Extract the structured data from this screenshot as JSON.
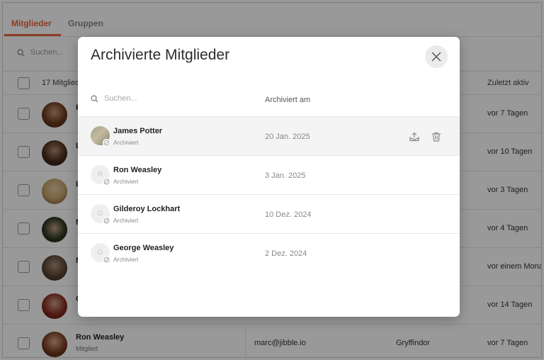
{
  "tabs": [
    {
      "label": "Mitglieder",
      "active": true
    },
    {
      "label": "Gruppen",
      "active": false
    }
  ],
  "background": {
    "search_placeholder": "Suchen...",
    "member_count_label": "17 Mitglied",
    "last_active_header": "Zuletzt aktiv",
    "rows": [
      {
        "initial": "H",
        "last_active": "vor 7 Tagen"
      },
      {
        "initial": "L",
        "last_active": "vor 10 Tagen"
      },
      {
        "initial": "L",
        "last_active": "vor 3 Tagen"
      },
      {
        "initial": "M",
        "last_active": "vor 4 Tagen"
      },
      {
        "initial": "M",
        "last_active": "vor einem Monat"
      },
      {
        "initial": "C",
        "last_active": "vor 14 Tagen"
      }
    ],
    "last_row": {
      "name": "Ron Weasley",
      "role": "Mitglied",
      "email": "marc@jibble.io",
      "group": "Gryffindor",
      "last_active": "vor 7 Tagen"
    }
  },
  "modal": {
    "title": "Archivierte Mitglieder",
    "search_placeholder": "Suchen...",
    "column_header": "Archiviert am",
    "members": [
      {
        "name": "James Potter",
        "status": "Archiviert",
        "date": "20 Jan. 2025",
        "avatar": "photo",
        "initial": ""
      },
      {
        "name": "Ron Weasley",
        "status": "Archiviert",
        "date": "3 Jan. 2025",
        "avatar": "initial",
        "initial": "R"
      },
      {
        "name": "Gilderoy Lockhart",
        "status": "Archiviert",
        "date": "10 Dez. 2024",
        "avatar": "initial",
        "initial": "G"
      },
      {
        "name": "George Weasley",
        "status": "Archiviert",
        "date": "2 Dez. 2024",
        "avatar": "initial",
        "initial": "G"
      }
    ]
  },
  "colors": {
    "accent": "#e8643a",
    "overlay": "rgba(0,0,0,0.40)"
  }
}
